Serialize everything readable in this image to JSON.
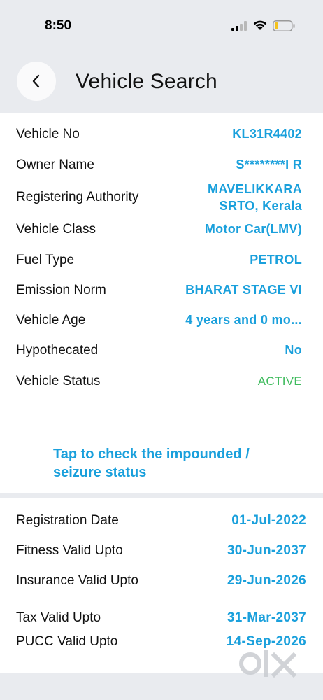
{
  "status_bar": {
    "time": "8:50"
  },
  "header": {
    "title": "Vehicle Search"
  },
  "vehicle_details": [
    {
      "label": "Vehicle No",
      "value": "KL31R4402"
    },
    {
      "label": "Owner Name",
      "value": "S********I R"
    },
    {
      "label": "Registering Authority",
      "value_line1": "MAVELIKKARA",
      "value_line2": "SRTO, Kerala"
    },
    {
      "label": "Vehicle Class",
      "value": "Motor Car(LMV)"
    },
    {
      "label": "Fuel Type",
      "value": "PETROL"
    },
    {
      "label": "Emission Norm",
      "value": "BHARAT STAGE VI"
    },
    {
      "label": "Vehicle Age",
      "value": "4 years and 0 mo..."
    },
    {
      "label": "Hypothecated",
      "value": "No"
    },
    {
      "label": "Vehicle Status",
      "value": "ACTIVE"
    }
  ],
  "impound_link": {
    "text": "Tap to check the impounded / seizure status"
  },
  "validity_details": [
    {
      "label": "Registration Date",
      "value": "01-Jul-2022"
    },
    {
      "label": "Fitness Valid Upto",
      "value": "30-Jun-2037"
    },
    {
      "label": "Insurance Valid Upto",
      "value": "29-Jun-2026"
    },
    {
      "label": "Tax Valid Upto",
      "value": "31-Mar-2037"
    },
    {
      "label": "PUCC Valid Upto",
      "value": "14-Sep-2026"
    }
  ],
  "colors": {
    "accent": "#1aa0dc",
    "status_active": "#3dbb5c",
    "background": "#e9ebef"
  },
  "icons": {
    "back": "chevron-left-icon",
    "signal": "cellular-signal-icon",
    "wifi": "wifi-icon",
    "battery": "battery-low-icon",
    "watermark": "olx-logo"
  }
}
